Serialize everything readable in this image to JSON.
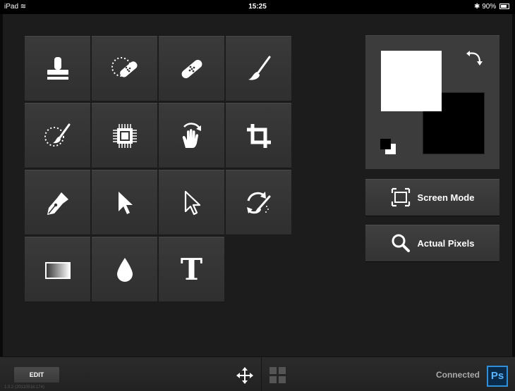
{
  "status_bar": {
    "device": "iPad",
    "wifi_icon": "wifi-icon",
    "time": "15:25",
    "battery": "90%"
  },
  "tools": [
    {
      "name": "stamp",
      "icon": "clone-stamp-icon"
    },
    {
      "name": "spot-healing",
      "icon": "spot-healing-bandage-icon"
    },
    {
      "name": "healing",
      "icon": "healing-bandage-icon"
    },
    {
      "name": "brush",
      "icon": "paint-brush-icon"
    },
    {
      "name": "quick-selection",
      "icon": "quick-selection-brush-icon"
    },
    {
      "name": "chip",
      "icon": "chip-icon"
    },
    {
      "name": "hand",
      "icon": "hand-rotate-icon"
    },
    {
      "name": "crop",
      "icon": "crop-icon"
    },
    {
      "name": "pen",
      "icon": "pen-nib-icon"
    },
    {
      "name": "move",
      "icon": "arrow-filled-icon"
    },
    {
      "name": "direct-select",
      "icon": "arrow-outline-icon"
    },
    {
      "name": "history-brush",
      "icon": "history-brush-icon"
    },
    {
      "name": "gradient",
      "icon": "gradient-icon"
    },
    {
      "name": "blur",
      "icon": "drop-icon"
    },
    {
      "name": "type",
      "icon": "type-icon",
      "glyph": "T"
    }
  ],
  "colors": {
    "foreground": "#ffffff",
    "background": "#000000"
  },
  "buttons": {
    "screen_mode": "Screen Mode",
    "actual_pixels": "Actual Pixels"
  },
  "bottom_bar": {
    "edit": "EDIT",
    "version": "1.0.2 (20110518.174)",
    "connected": "Connected",
    "ps_logo": "Ps"
  }
}
